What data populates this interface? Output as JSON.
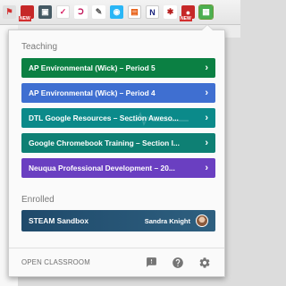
{
  "popup": {
    "teaching_heading": "Teaching",
    "enrolled_heading": "Enrolled",
    "teaching": [
      {
        "name": "AP Environmental (Wick) – Period 5",
        "color": "#0b8043"
      },
      {
        "name": "AP Environmental (Wick) – Period 4",
        "color": "#3f6fd1"
      },
      {
        "name": "DTL Google Resources – Section Aweso...",
        "color": "#0b8a8a"
      },
      {
        "name": "Google Chromebook Training – Section I...",
        "color": "#0e8074"
      },
      {
        "name": "Neuqua Professional Development – 20...",
        "color": "#6a3fc1"
      }
    ],
    "enrolled": [
      {
        "name": "STEAM Sandbox",
        "teacher": "Sandra Knight",
        "color": "#1f4a6b"
      }
    ],
    "footer": {
      "open_label": "OPEN CLASSROOM",
      "feedback_icon": "feedback-icon",
      "help_icon": "help-icon",
      "settings_icon": "settings-icon"
    }
  },
  "toolbar": {
    "icons": [
      "flag-icon",
      "ruby-icon",
      "extension-icon",
      "pocket-icon",
      "pinterest-icon",
      "eyedropper-icon",
      "camera-icon",
      "clipboard-icon",
      "notebook-icon",
      "bug-icon",
      "new-badge-icon",
      "google-classroom-icon"
    ],
    "badge": "NEW"
  }
}
